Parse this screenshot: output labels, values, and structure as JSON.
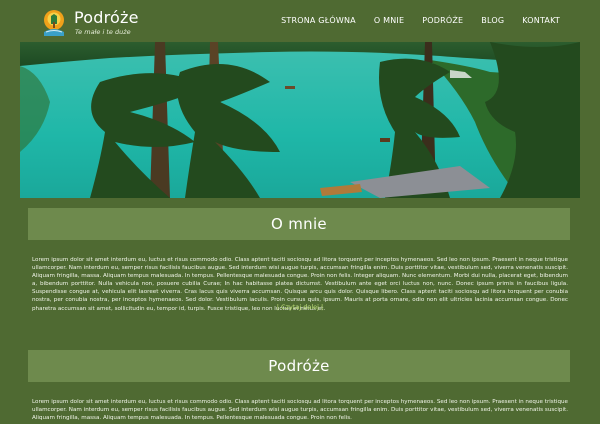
{
  "header": {
    "title": "Podróże",
    "tagline": "Te małe i te duże",
    "nav": [
      "STRONA GŁÓWNA",
      "O MNIE",
      "PODRÓŻE",
      "BLOG",
      "KONTAKT"
    ]
  },
  "hero": {
    "icon": "lake-forest-photo"
  },
  "sections": [
    {
      "title": "O mnie",
      "text": "Lorem ipsum dolor sit amet interdum eu, luctus et risus commodo odio. Class aptent taciti sociosqu ad litora torquent per inceptos hymenaeos. Sed leo non ipsum. Praesent in neque tristique ullamcorper. Nam interdum eu, semper risus facilisis faucibus augue. Sed interdum wisi augue turpis, accumsan fringilla enim. Duis porttitor vitae, vestibulum sed, viverra venenatis suscipit. Aliquam fringilla, massa. Aliquam tempus malesuada. In tempus. Pellentesque malesuada congue. Proin non felis. Integer aliquam. Nunc elementum. Morbi dui nulla, placerat eget, bibendum a, bibendum porttitor. Nulla vehicula non, posuere cubilia Curae; In hac habitasse platea dictumst. Vestibulum ante eget orci luctus non, nunc. Donec ipsum primis in faucibus ligula. Suspendisse congue at, vehicula elit laoreet viverra. Cras lacus quis viverra accumsan. Quisque arcu quis dolor. Quisque libero. Class aptent taciti sociosqu ad litora torquent per conubia nostra, per conubia nostra, per inceptos hymenaeos. Sed dolor. Vestibulum iaculis. Proin cursus quis, ipsum. Mauris at porta ornare, odio non elit ultricies lacinia accumsan congue. Donec pharetra accumsan sit amet, sollicitudin eu, tempor id, turpis. Fusce tristique, leo non luctus et netus et.",
      "read_more": "| Czytaj dalej |"
    },
    {
      "title": "Podróże",
      "text": "Lorem ipsum dolor sit amet interdum eu, luctus et risus commodo odio. Class aptent taciti sociosqu ad litora torquent per inceptos hymenaeos. Sed leo non ipsum. Praesent in neque tristique ullamcorper. Nam interdum eu, semper risus facilisis faucibus augue. Sed interdum wisi augue turpis, accumsan fringilla enim. Duis porttitor vitae, vestibulum sed, viverra venenatis suscipit. Aliquam fringilla, massa. Aliquam tempus malesuada. In tempus. Pellentesque malesuada congue. Proin non felis."
    }
  ],
  "colors": {
    "background": "#4f6a32",
    "panel": "#6e8a4d",
    "link_accent": "#bfe07a"
  }
}
